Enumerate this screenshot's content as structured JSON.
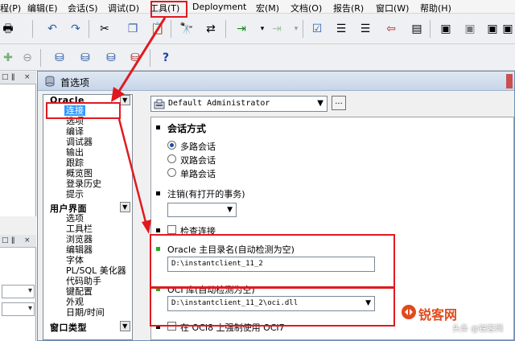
{
  "menubar": {
    "items": [
      "程(P)",
      "编辑(E)",
      "会话(S)",
      "调试(D)",
      "工具(T)",
      "Deployment",
      "宏(M)",
      "文档(O)",
      "报告(R)",
      "窗口(W)",
      "帮助(H)"
    ]
  },
  "dialog": {
    "title": "首选项"
  },
  "tree": {
    "groups": [
      {
        "label": "Oracle",
        "items": [
          "连接",
          "选项",
          "编译",
          "调试器",
          "输出",
          "跟踪",
          "概览图",
          "登录历史",
          "提示"
        ]
      },
      {
        "label": "用户界面",
        "items": [
          "选项",
          "工具栏",
          "浏览器",
          "编辑器",
          "字体",
          "PL/SQL 美化器",
          "代码助手",
          "键配置",
          "外观",
          "日期/时间"
        ]
      },
      {
        "label": "窗口类型",
        "items": []
      }
    ],
    "selected": "连接"
  },
  "profile": {
    "value": "Default Administrator",
    "ellipsis": "..."
  },
  "session": {
    "title": "会话方式",
    "options": [
      "多路会话",
      "双路会话",
      "单路会话"
    ],
    "selected": "多路会话"
  },
  "logoff": {
    "label": "注销(有打开的事务)",
    "value": ""
  },
  "check_connection": {
    "label": "检查连接",
    "checked": false
  },
  "oracle_home": {
    "label": "Oracle 主目录名(自动检测为空)",
    "value": "D:\\instantclient_11_2"
  },
  "oci_library": {
    "label": "OCI 库(自动检测为空)",
    "value": "D:\\instantclient_11_2\\oci.dll"
  },
  "force_oci7": {
    "label": "在 OCI8 上强制使用 OCI7",
    "checked": false
  },
  "watermark": {
    "text": "锐客网",
    "sub": "头条 @锐客网"
  },
  "colors": {
    "annotation": "#e0191f",
    "selection": "#3399ff",
    "marker_green": "#1fb01f"
  }
}
